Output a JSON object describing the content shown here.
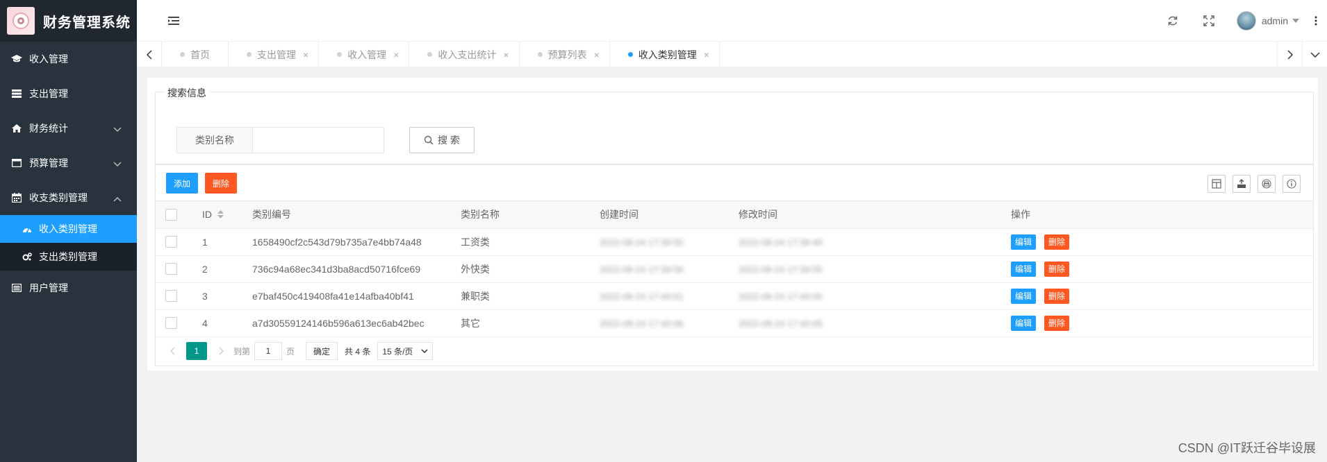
{
  "app": {
    "title": "财务管理系统"
  },
  "sidebar": {
    "items": [
      {
        "label": "收入管理"
      },
      {
        "label": "支出管理"
      },
      {
        "label": "财务统计"
      },
      {
        "label": "预算管理"
      },
      {
        "label": "收支类别管理"
      },
      {
        "label": "用户管理"
      }
    ],
    "sub_items": [
      {
        "label": "收入类别管理"
      },
      {
        "label": "支出类别管理"
      }
    ]
  },
  "header": {
    "username": "admin"
  },
  "tabs": [
    {
      "label": "首页"
    },
    {
      "label": "支出管理"
    },
    {
      "label": "收入管理"
    },
    {
      "label": "收入支出统计"
    },
    {
      "label": "预算列表"
    },
    {
      "label": "收入类别管理"
    }
  ],
  "search": {
    "legend": "搜索信息",
    "label": "类别名称",
    "value": "",
    "button": "搜 索"
  },
  "toolbar": {
    "add": "添加",
    "delete": "删除"
  },
  "table": {
    "columns": [
      "ID",
      "类别编号",
      "类别名称",
      "创建时间",
      "修改时间",
      "操作"
    ],
    "rows": [
      {
        "id": "1",
        "code": "1658490cf2c543d79b735a7e4bb74a48",
        "name": "工资类",
        "created": "2022-08-24 17:39:55",
        "modified": "2022-08-24 17:39:49"
      },
      {
        "id": "2",
        "code": "736c94a68ec341d3ba8acd50716fce69",
        "name": "外快类",
        "created": "2022-08-24 17:39:56",
        "modified": "2022-08-24 17:39:55"
      },
      {
        "id": "3",
        "code": "e7baf450c419408fa41e14afba40bf41",
        "name": "兼职类",
        "created": "2022-08-24 17:40:01",
        "modified": "2022-08-24 17:40:00"
      },
      {
        "id": "4",
        "code": "a7d30559124146b596a613ec6ab42bec",
        "name": "其它",
        "created": "2022-08-24 17:40:06",
        "modified": "2022-08-24 17:40:05"
      }
    ],
    "edit_label": "编辑",
    "delete_label": "删除"
  },
  "pager": {
    "current": "1",
    "goto_label": "到第",
    "page_value": "1",
    "page_unit": "页",
    "confirm": "确定",
    "total": "共 4 条",
    "per_page": "15 条/页"
  },
  "watermark": "CSDN @IT跃迁谷毕设展",
  "colors": {
    "primary": "#1e9fff",
    "danger": "#ff5722",
    "pager_active": "#009688",
    "sidebar": "#28333e"
  }
}
